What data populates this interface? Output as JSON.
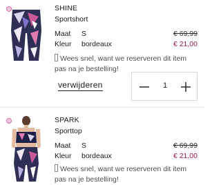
{
  "cart_items": [
    {
      "brand": "SHINE",
      "name": "Sportshort",
      "size_label": "Maat",
      "size_value": "S",
      "color_label": "Kleur",
      "color_value": "bordeaux",
      "old_price": "€ 69,99",
      "new_price": "€ 21,00",
      "notice": "Wees snel, want we reserveren dit item pas na je bestelling!",
      "remove_label": "verwijderen",
      "quantity": "1",
      "thumbnail_icon": "sportshort-image"
    },
    {
      "brand": "SPARK",
      "name": "Sporttop",
      "size_label": "Maat",
      "size_value": "S",
      "color_label": "Kleur",
      "color_value": "bordeaux",
      "old_price": "€ 69,99",
      "new_price": "€ 21,00",
      "notice": "Wees snel, want we reserveren dit item pas na je bestelling!",
      "thumbnail_icon": "sporttop-image"
    }
  ],
  "colors": {
    "sale_price": "#9b1b3b",
    "badge": "#f6c9e0"
  }
}
